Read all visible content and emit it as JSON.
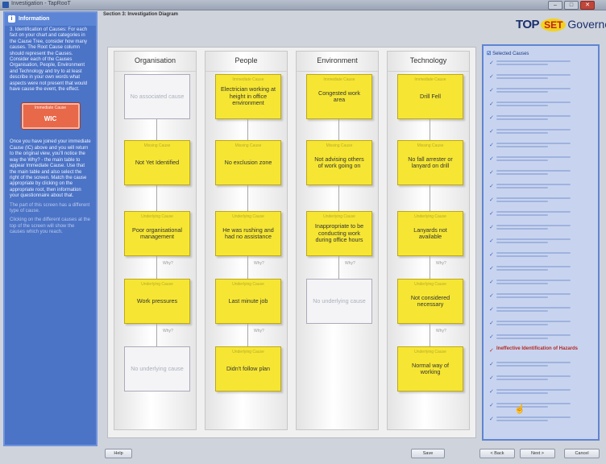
{
  "window": {
    "title": "Investigation - TapRooT",
    "buttons": [
      "–",
      "□",
      "✕"
    ]
  },
  "left_panel": {
    "title": "Information",
    "paragraph1": "3. Identification of Causes: For each fact on your chart and categories in the Cause Tree, consider how many causes. The Root Cause column should represent the Causes. Consider each of the Causes Organisation, People, Environment and Technology and try to at least describe in your own words what aspects were not present that would have cause the event, the effect.",
    "cause_box": {
      "label": "Immediate Cause",
      "value": "WIC"
    },
    "paragraph2": "Once you have joined your immediate Cause (IC) above and you will return to the original view, you'll notice the way the Why? - the main table to appear Immediate Cause. Use that the main table and also select the right of the screen. Match the cause appropriate by clicking on the appropriate root, then information your questionnaire about that.",
    "paragraph3": "The part of this screen has a different type of cause.",
    "paragraph4": "Clicking on the different causes at the top of the screen will show the causes which you reach."
  },
  "header": {
    "title": "Section 3: Investigation Diagram"
  },
  "logo": {
    "top": "TOP",
    "set": "SET",
    "tail": "Governor"
  },
  "diagram": {
    "why_label": "Why?",
    "columns": [
      {
        "name": "Organisation",
        "cards": [
          {
            "label": "",
            "text": "No associated cause",
            "empty": true
          },
          {
            "label": "Missing Cause",
            "text": "Not Yet Identified",
            "empty": false
          },
          {
            "label": "Underlying Cause",
            "text": "Poor organisational management",
            "empty": false
          },
          {
            "label": "Underlying Cause",
            "text": "Work pressures",
            "empty": false
          },
          {
            "label": "",
            "text": "No underlying cause",
            "empty": true
          }
        ]
      },
      {
        "name": "People",
        "cards": [
          {
            "label": "Immediate Cause",
            "text": "Electrician working at height in office environment",
            "empty": false
          },
          {
            "label": "Missing Cause",
            "text": "No exclusion zone",
            "empty": false
          },
          {
            "label": "Underlying Cause",
            "text": "He was rushing and had no assistance",
            "empty": false
          },
          {
            "label": "Underlying Cause",
            "text": "Last minute job",
            "empty": false
          },
          {
            "label": "Underlying Cause",
            "text": "Didn't follow plan",
            "empty": false
          }
        ]
      },
      {
        "name": "Environment",
        "cards": [
          {
            "label": "Immediate Cause",
            "text": "Congested work area",
            "empty": false
          },
          {
            "label": "Missing Cause",
            "text": "Not advising others of work going on",
            "empty": false
          },
          {
            "label": "Underlying Cause",
            "text": "Inappropriate to be conducting work during office hours",
            "empty": false
          },
          {
            "label": "",
            "text": "No underlying cause",
            "empty": true
          }
        ]
      },
      {
        "name": "Technology",
        "cards": [
          {
            "label": "Immediate Cause",
            "text": "Drill Fell",
            "empty": false
          },
          {
            "label": "Missing Cause",
            "text": "No fall arrester or lanyard on drill",
            "empty": false
          },
          {
            "label": "Underlying Cause",
            "text": "Lanyards not available",
            "empty": false
          },
          {
            "label": "Underlying Cause",
            "text": "Not considered necessary",
            "empty": false
          },
          {
            "label": "Underlying Cause",
            "text": "Normal way of working",
            "empty": false
          }
        ]
      }
    ]
  },
  "right_panel": {
    "title": "Selected Causes",
    "highlighted_item": "Ineffective Identification of Hazards",
    "item_count_before": 21,
    "item_count_after": 5
  },
  "footer": {
    "help": "Help",
    "save": "Save",
    "back": "< Back",
    "next": "Next >",
    "cancel": "Cancel"
  }
}
